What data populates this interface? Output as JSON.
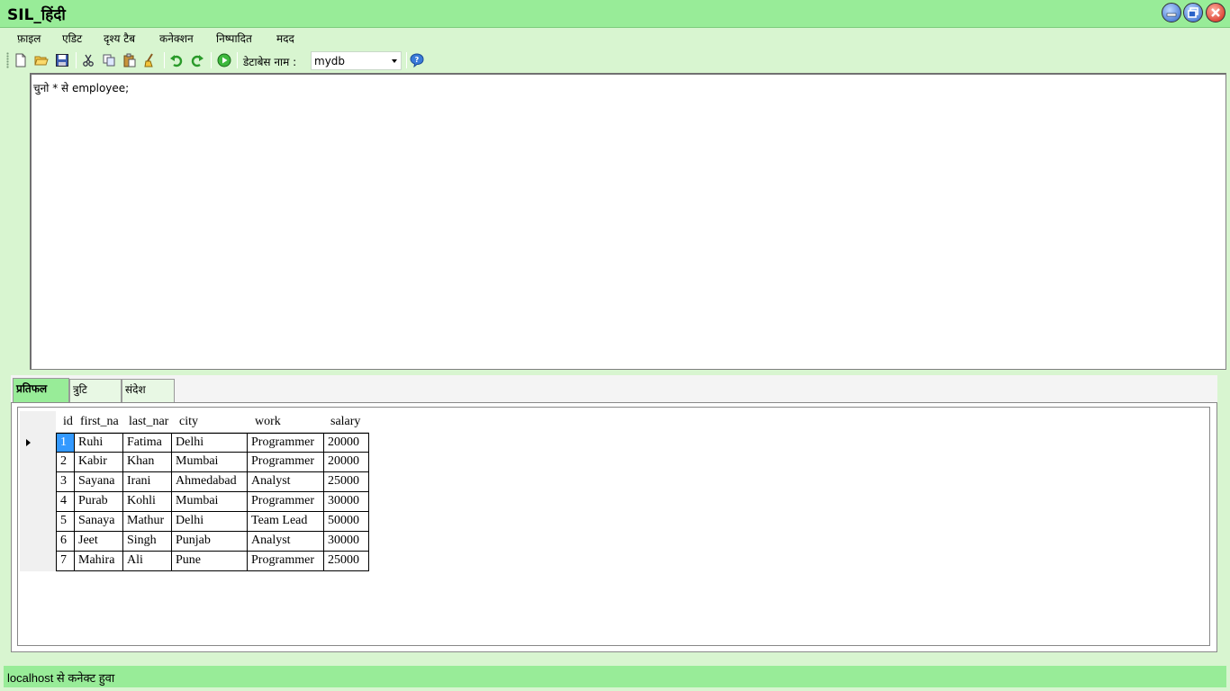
{
  "window": {
    "title": "SIL_हिंदी"
  },
  "menu": {
    "items": [
      "फ़ाइल",
      "एडिट",
      "दृश्य टैब",
      "कनेक्शन",
      "निष्पादित",
      "मदद"
    ]
  },
  "toolbar": {
    "icons": [
      "new-file-icon",
      "open-folder-icon",
      "save-icon",
      "cut-icon",
      "copy-icon",
      "paste-icon",
      "clear-icon",
      "undo-icon",
      "redo-icon",
      "run-icon",
      "help-icon"
    ],
    "db_label": "डेटाबेस नाम :",
    "db_selected": "mydb"
  },
  "editor": {
    "query": "चुनो * से employee;"
  },
  "tabs": [
    {
      "label": "प्रतिफल",
      "active": true
    },
    {
      "label": "त्रुटि",
      "active": false
    },
    {
      "label": "संदेश",
      "active": false
    }
  ],
  "grid": {
    "columns": [
      "id",
      "first_na",
      "last_nar",
      "city",
      "work",
      "salary"
    ],
    "rows": [
      [
        "1",
        "Ruhi",
        "Fatima",
        "Delhi",
        "Programmer",
        "20000"
      ],
      [
        "2",
        "Kabir",
        "Khan",
        "Mumbai",
        "Programmer",
        "20000"
      ],
      [
        "3",
        "Sayana",
        "Irani",
        "Ahmedabad",
        "Analyst",
        "25000"
      ],
      [
        "4",
        "Purab",
        "Kohli",
        "Mumbai",
        "Programmer",
        "30000"
      ],
      [
        "5",
        "Sanaya",
        "Mathur",
        "Delhi",
        "Team Lead",
        "50000"
      ],
      [
        "6",
        "Jeet",
        "Singh",
        "Punjab",
        "Analyst",
        "30000"
      ],
      [
        "7",
        "Mahira",
        "Ali",
        "Pune",
        "Programmer",
        "25000"
      ]
    ],
    "selected_row": 0
  },
  "status": {
    "text": "localhost  से कनेक्ट हुवा"
  }
}
